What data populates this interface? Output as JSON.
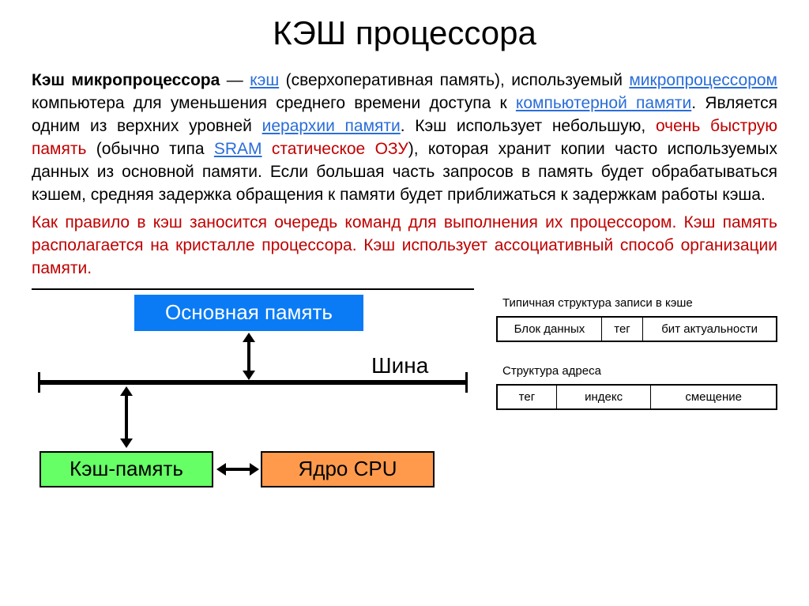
{
  "title": "КЭШ процессора",
  "p1": {
    "lead": "Кэш микропроцессора",
    "s1": " — ",
    "link_cache": "кэш",
    "s2": " (сверхоперативная память), используемый ",
    "link_mp": "микропроцессором",
    "s3": " компьютера для уменьшения среднего времени доступа к ",
    "link_mem": "компьютерной памяти",
    "s4": ". Является одним из верхних уровней ",
    "link_hier": "иерархии памяти",
    "s5": ". Кэш использует небольшую, ",
    "fast": "очень быструю память",
    "s6": " (обычно типа ",
    "link_sram": "SRAM",
    "s7": " ",
    "sram_ru": "статическое ОЗУ",
    "s8": "), которая хранит копии часто используемых данных из основной памяти. Если большая часть запросов в память будет обрабатываться кэшем, средняя задержка обращения к памяти будет приближаться к задержкам работы кэша."
  },
  "p2": "Как правило в кэш заносится очередь команд для выполнения их процессором. Кэш память располагается на кристалле процессора.  Кэш использует ассоциативный способ организации памяти.",
  "diagram": {
    "main_memory": "Основная память",
    "bus": "Шина",
    "cache": "Кэш-память",
    "cpu_core": "Ядро CPU"
  },
  "tables": {
    "cache_record_title": "Типичная структура записи в кэше",
    "cache_record": [
      "Блок данных",
      "тег",
      "бит актуальности"
    ],
    "addr_title": "Структура адреса",
    "addr": [
      "тег",
      "индекс",
      "смещение"
    ]
  }
}
